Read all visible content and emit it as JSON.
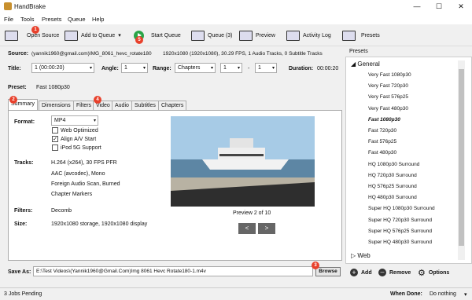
{
  "window": {
    "title": "HandBrake",
    "minimize": "—",
    "maximize": "☐",
    "close": "✕"
  },
  "menu": [
    "File",
    "Tools",
    "Presets",
    "Queue",
    "Help"
  ],
  "toolbar": {
    "open_source": "Open Source",
    "add_to_queue": "Add to Queue",
    "start_queue": "Start Queue",
    "queue": "Queue (3)",
    "preview": "Preview",
    "activity_log": "Activity Log",
    "presets": "Presets"
  },
  "badges": {
    "b1": "1",
    "b2": "2",
    "b3": "3",
    "b4": "4",
    "b5": "5"
  },
  "source": {
    "label": "Source:",
    "name": "(yannik1960@gmail.com)IMG_8061_hevc_rotate180",
    "info": "1920x1080 (1920x1080), 30.29 FPS, 1 Audio Tracks, 0 Subtitle Tracks"
  },
  "title_row": {
    "title_label": "Title:",
    "title_value": "1 (00:00:20)",
    "angle_label": "Angle:",
    "angle_value": "1",
    "range_label": "Range:",
    "range_value": "Chapters",
    "from": "1",
    "dash": "-",
    "to": "1",
    "duration_label": "Duration:",
    "duration_value": "00:00:20"
  },
  "preset_row": {
    "label": "Preset:",
    "value": "Fast 1080p30"
  },
  "tabs": [
    "Summary",
    "Dimensions",
    "Filters",
    "Video",
    "Audio",
    "Subtitles",
    "Chapters"
  ],
  "summary": {
    "format_label": "Format:",
    "format_value": "MP4",
    "web_optimized": "Web Optimized",
    "align_av": "Align A/V Start",
    "ipod": "iPod 5G Support",
    "tracks_label": "Tracks:",
    "tracks": [
      "H.264 (x264), 30 FPS PFR",
      "AAC (avcodec), Mono",
      "Foreign Audio Scan, Burned",
      "Chapter Markers"
    ],
    "filters_label": "Filters:",
    "filters_value": "Decomb",
    "size_label": "Size:",
    "size_value": "1920x1080 storage, 1920x1080 display",
    "preview_caption": "Preview 2 of 10",
    "prev": "<",
    "next": ">"
  },
  "save": {
    "label": "Save As:",
    "value": "E:\\Test Videos\\(Yannik1960@Gmail.Com)Img 8061 Hevc Rotate180-1.m4v",
    "browse": "Browse"
  },
  "presets_panel": {
    "title": "Presets",
    "general": "General",
    "items": [
      "Very Fast 1080p30",
      "Very Fast 720p30",
      "Very Fast 576p25",
      "Very Fast 480p30",
      "Fast 1080p30",
      "Fast 720p30",
      "Fast 576p25",
      "Fast 480p30",
      "HQ 1080p30 Surround",
      "HQ 720p30 Surround",
      "HQ 576p25 Surround",
      "HQ 480p30 Surround",
      "Super HQ 1080p30 Surround",
      "Super HQ 720p30 Surround",
      "Super HQ 576p25 Surround",
      "Super HQ 480p30 Surround"
    ],
    "selected_index": 4,
    "web": "Web",
    "add": "Add",
    "remove": "Remove",
    "options": "Options"
  },
  "status": {
    "jobs": "3 Jobs Pending",
    "when_done_label": "When Done:",
    "when_done_value": "Do nothing"
  }
}
